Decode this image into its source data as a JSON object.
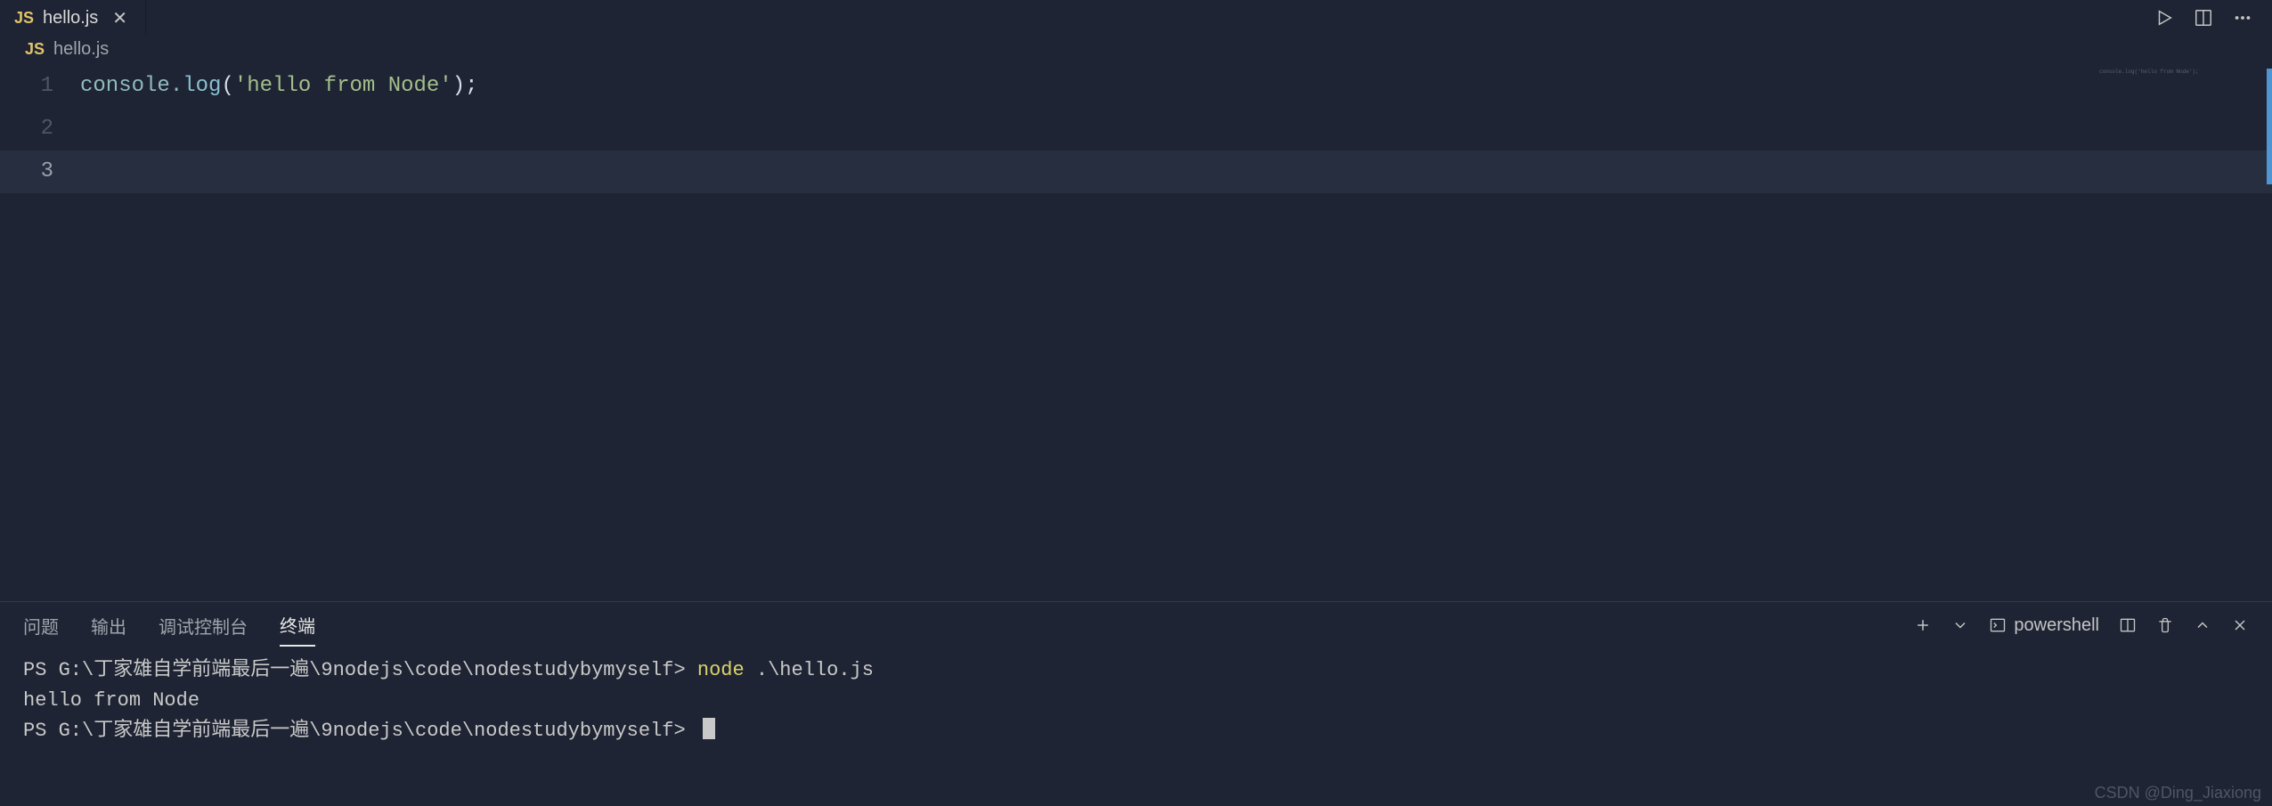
{
  "tab": {
    "icon": "JS",
    "filename": "hello.js"
  },
  "breadcrumb": {
    "icon": "JS",
    "file": "hello.js"
  },
  "code": {
    "line1": {
      "num": "1",
      "obj": "console",
      "dot": ".",
      "fn": "log",
      "open": "(",
      "str": "'hello from Node'",
      "close": ")",
      "semi": ";"
    },
    "line2": {
      "num": "2"
    },
    "line3": {
      "num": "3"
    }
  },
  "minimap": {
    "line1": "console.log('hello from Node');"
  },
  "panel_tabs": {
    "problems": "问题",
    "output": "输出",
    "debug": "调试控制台",
    "terminal": "终端"
  },
  "panel_actions": {
    "shell": "powershell"
  },
  "terminal": {
    "prompt1": "PS G:\\丁家雄自学前端最后一遍\\9nodejs\\code\\nodestudybymyself> ",
    "cmd": "node",
    "args": " .\\hello.js",
    "output": "hello from Node",
    "prompt2": "PS G:\\丁家雄自学前端最后一遍\\9nodejs\\code\\nodestudybymyself> "
  },
  "watermark": "CSDN @Ding_Jiaxiong"
}
